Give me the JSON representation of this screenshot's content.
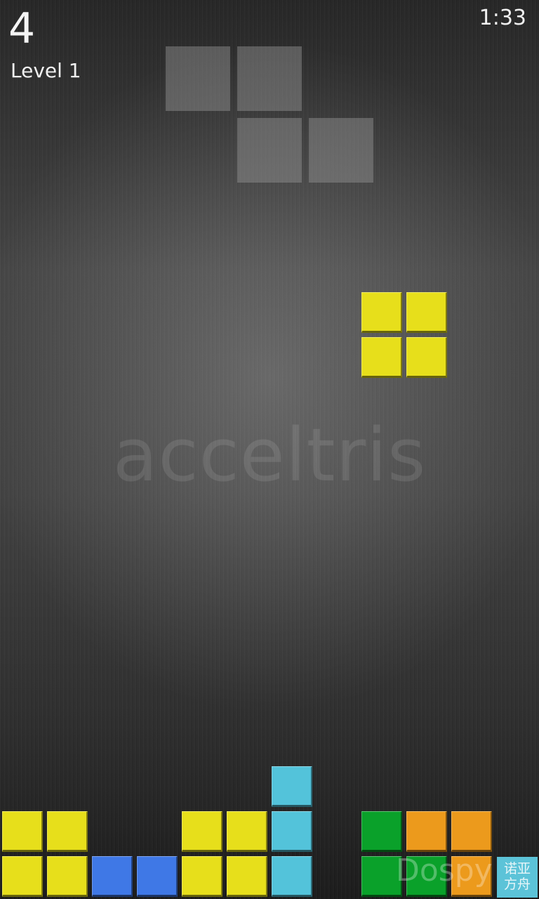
{
  "hud": {
    "score": "4",
    "level": "Level 1",
    "timer": "1:33"
  },
  "game": {
    "title": "acceltris",
    "colors": {
      "yellow": "#e7df1b",
      "blue": "#3f78e6",
      "cyan": "#53c3da",
      "green": "#0aa12a",
      "orange": "#ec9a1c",
      "ghost": "#9a9a9a"
    },
    "next_piece": "Z",
    "active_piece": "O",
    "board_columns": 12,
    "active_cells": [
      [
        8,
        6
      ],
      [
        9,
        6
      ],
      [
        8,
        7
      ],
      [
        9,
        7
      ]
    ],
    "stack_cells": [
      {
        "col": 0,
        "row": 18,
        "color": "yellow"
      },
      {
        "col": 1,
        "row": 18,
        "color": "yellow"
      },
      {
        "col": 0,
        "row": 19,
        "color": "yellow"
      },
      {
        "col": 1,
        "row": 19,
        "color": "yellow"
      },
      {
        "col": 2,
        "row": 19,
        "color": "blue"
      },
      {
        "col": 3,
        "row": 19,
        "color": "blue"
      },
      {
        "col": 4,
        "row": 18,
        "color": "yellow"
      },
      {
        "col": 5,
        "row": 18,
        "color": "yellow"
      },
      {
        "col": 4,
        "row": 19,
        "color": "yellow"
      },
      {
        "col": 5,
        "row": 19,
        "color": "yellow"
      },
      {
        "col": 6,
        "row": 17,
        "color": "cyan"
      },
      {
        "col": 6,
        "row": 18,
        "color": "cyan"
      },
      {
        "col": 6,
        "row": 19,
        "color": "cyan"
      },
      {
        "col": 8,
        "row": 18,
        "color": "green"
      },
      {
        "col": 8,
        "row": 19,
        "color": "green"
      },
      {
        "col": 9,
        "row": 19,
        "color": "green"
      },
      {
        "col": 9,
        "row": 18,
        "color": "orange"
      },
      {
        "col": 10,
        "row": 18,
        "color": "orange"
      },
      {
        "col": 10,
        "row": 19,
        "color": "orange"
      }
    ]
  },
  "overlay": {
    "brand": "Dospy",
    "sticker_line1": "诺亚",
    "sticker_line2": "方舟"
  }
}
